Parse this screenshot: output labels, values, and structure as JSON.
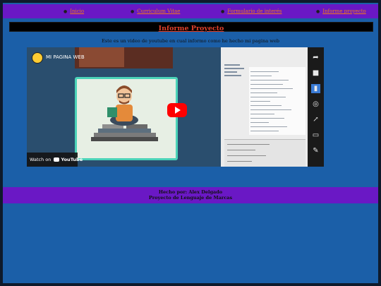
{
  "nav": {
    "items": [
      {
        "label": "Inicio"
      },
      {
        "label": "Curriculum Vitae"
      },
      {
        "label": "Formulario de interés"
      },
      {
        "label": "Informe proyecto"
      }
    ]
  },
  "header": {
    "title": "Informe Proyecto"
  },
  "main": {
    "description": "Este es un video de youtube en cual informo como he hecho mi pagina web",
    "video": {
      "channel_name": "MI PAGINA WEB",
      "watch_on_label": "Watch on",
      "youtube_label": "YouTube"
    }
  },
  "footer": {
    "line1": "Hecho por: Alex Delgado",
    "line2": "Proyecto de Lenguaje de Marcas"
  },
  "colors": {
    "page_background": "#1b5fa8",
    "nav_background": "#6a18c5",
    "link_color": "#f07a1a",
    "title_color": "#e0402a",
    "title_bar_background": "#000000"
  }
}
